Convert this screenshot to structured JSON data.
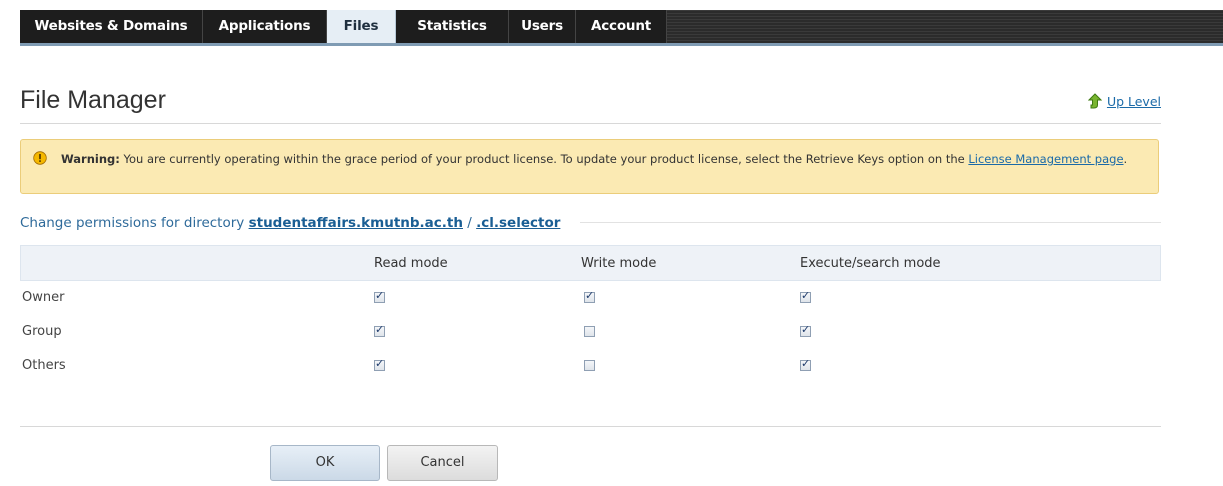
{
  "nav": {
    "tabs": [
      {
        "label": "Websites & Domains",
        "active": false
      },
      {
        "label": "Applications",
        "active": false
      },
      {
        "label": "Files",
        "active": true
      },
      {
        "label": "Statistics",
        "active": false
      },
      {
        "label": "Users",
        "active": false
      },
      {
        "label": "Account",
        "active": false
      }
    ]
  },
  "header": {
    "title": "File Manager",
    "up_level": "Up Level"
  },
  "warning": {
    "label": "Warning:",
    "text": " You are currently operating within the grace period of your product license. To update your product license, select the Retrieve Keys option on the ",
    "link": "License Management page",
    "suffix": "."
  },
  "permissions": {
    "prefix": "Change permissions for directory ",
    "domain": "studentaffairs.kmutnb.ac.th",
    "separator": " / ",
    "dir": ".cl.selector",
    "columns": [
      "",
      "Read mode",
      "Write mode",
      "Execute/search mode"
    ],
    "rows": [
      {
        "label": "Owner",
        "read": true,
        "write": true,
        "execute": true
      },
      {
        "label": "Group",
        "read": true,
        "write": false,
        "execute": true
      },
      {
        "label": "Others",
        "read": true,
        "write": false,
        "execute": true
      }
    ]
  },
  "buttons": {
    "ok": "OK",
    "cancel": "Cancel"
  },
  "colors": {
    "nav_bg": "#2b2b2b",
    "tab_active_bg": "#e6eef5",
    "warning_bg": "#fbeab3",
    "link": "#1a6aa8"
  }
}
